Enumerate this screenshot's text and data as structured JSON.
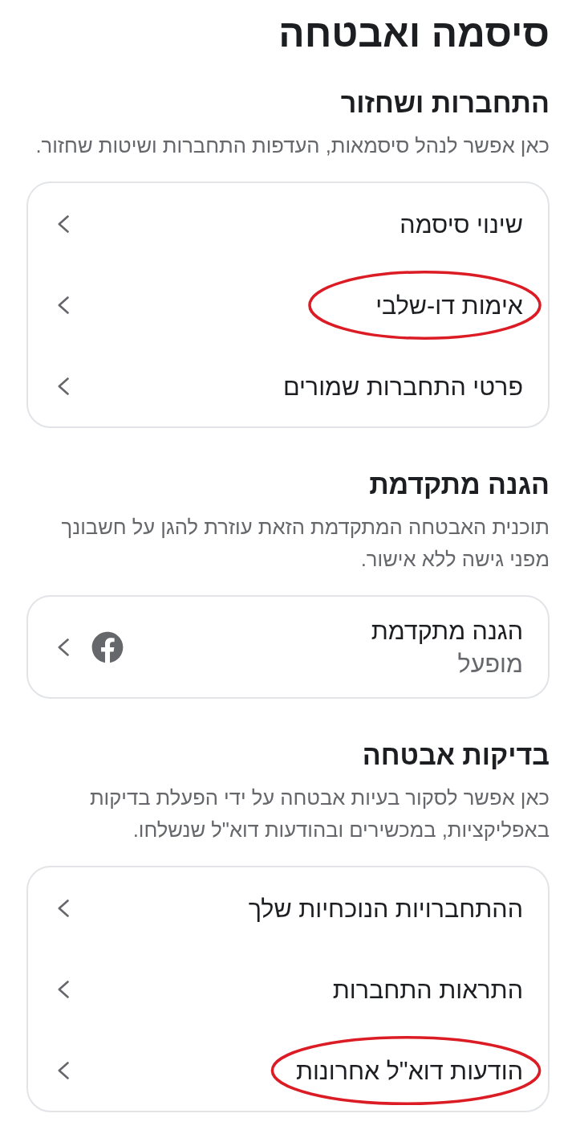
{
  "page": {
    "title": "סיסמה ואבטחה"
  },
  "sections": [
    {
      "heading": "התחברות ושחזור",
      "description": "כאן אפשר לנהל סיסמאות, העדפות התחברות ושיטות שחזור.",
      "items": [
        {
          "kind": "link",
          "label": "שינוי סיסמה",
          "circled": false
        },
        {
          "kind": "link",
          "label": "אימות דו-שלבי",
          "circled": true
        },
        {
          "kind": "link",
          "label": "פרטי התחברות שמורים",
          "circled": false
        }
      ]
    },
    {
      "heading": "הגנה מתקדמת",
      "description": "תוכנית האבטחה המתקדמת הזאת עוזרת להגן על חשבונך מפני גישה ללא אישור.",
      "items": [
        {
          "kind": "status",
          "label": "הגנה מתקדמת",
          "status": "מופעל",
          "circled": false
        }
      ]
    },
    {
      "heading": "בדיקות אבטחה",
      "description": "כאן אפשר לסקור בעיות אבטחה על ידי הפעלת בדיקות באפליקציות, במכשירים ובהודעות דוא\"ל שנשלחו.",
      "items": [
        {
          "kind": "link",
          "label": "ההתחברויות הנוכחיות שלך",
          "circled": false
        },
        {
          "kind": "link",
          "label": "התראות התחברות",
          "circled": false
        },
        {
          "kind": "link",
          "label": "הודעות דוא\"ל אחרונות",
          "circled": true
        }
      ]
    }
  ]
}
